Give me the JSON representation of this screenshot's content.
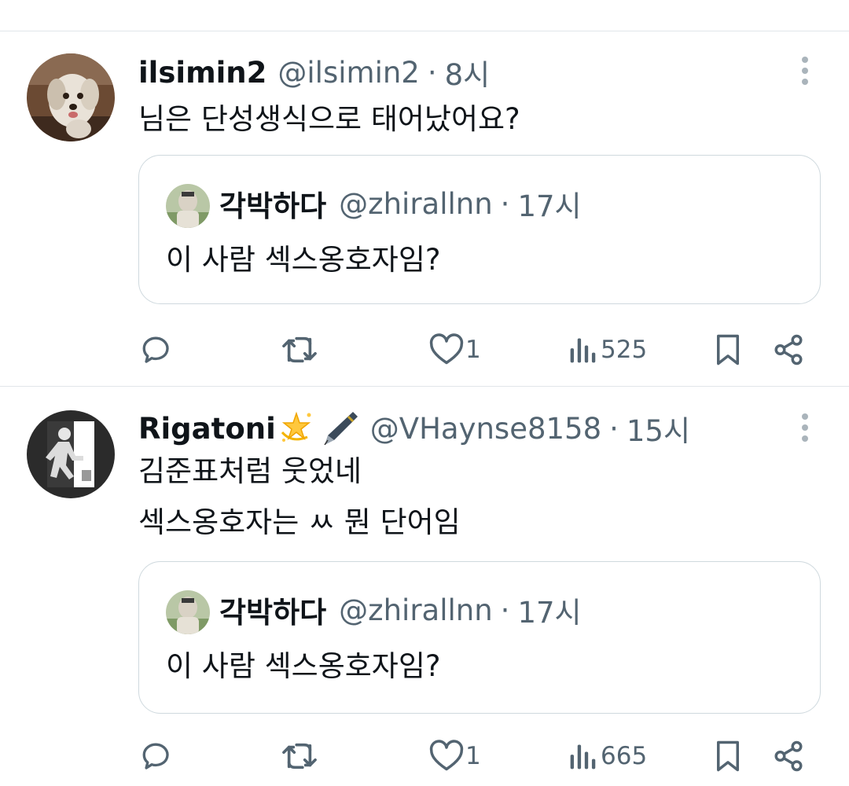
{
  "tweets": [
    {
      "display_name": "ilsimin2",
      "handle": "@ilsimin2",
      "time": "8시",
      "text_lines": [
        "님은 단성생식으로 태어났어요?"
      ],
      "quote": {
        "display_name": "각박하다",
        "handle": "@zhirallnn",
        "time": "17시",
        "text": "이 사람 섹스옹호자임?"
      },
      "likes": "1",
      "views": "525"
    },
    {
      "display_name": "Rigatoni",
      "name_emojis": [
        "dizzy-star-emoji",
        "fountain-pen-emoji"
      ],
      "handle": "@VHaynse8158",
      "time": "15시",
      "text_lines": [
        "김준표처럼 웃었네",
        "섹스옹호자는 ㅆ 뭔 단어임"
      ],
      "quote": {
        "display_name": "각박하다",
        "handle": "@zhirallnn",
        "time": "17시",
        "text": "이 사람 섹스옹호자임?"
      },
      "likes": "1",
      "views": "665"
    }
  ],
  "separator": "·",
  "icons": [
    "more-vertical-icon",
    "reply-icon",
    "retweet-icon",
    "like-icon",
    "views-icon",
    "bookmark-icon",
    "share-icon"
  ],
  "colors": {
    "text_primary": "#0f1419",
    "text_secondary": "#536471",
    "border": "#cfd9de",
    "divider": "#e1e6ea",
    "background": "#ffffff"
  }
}
